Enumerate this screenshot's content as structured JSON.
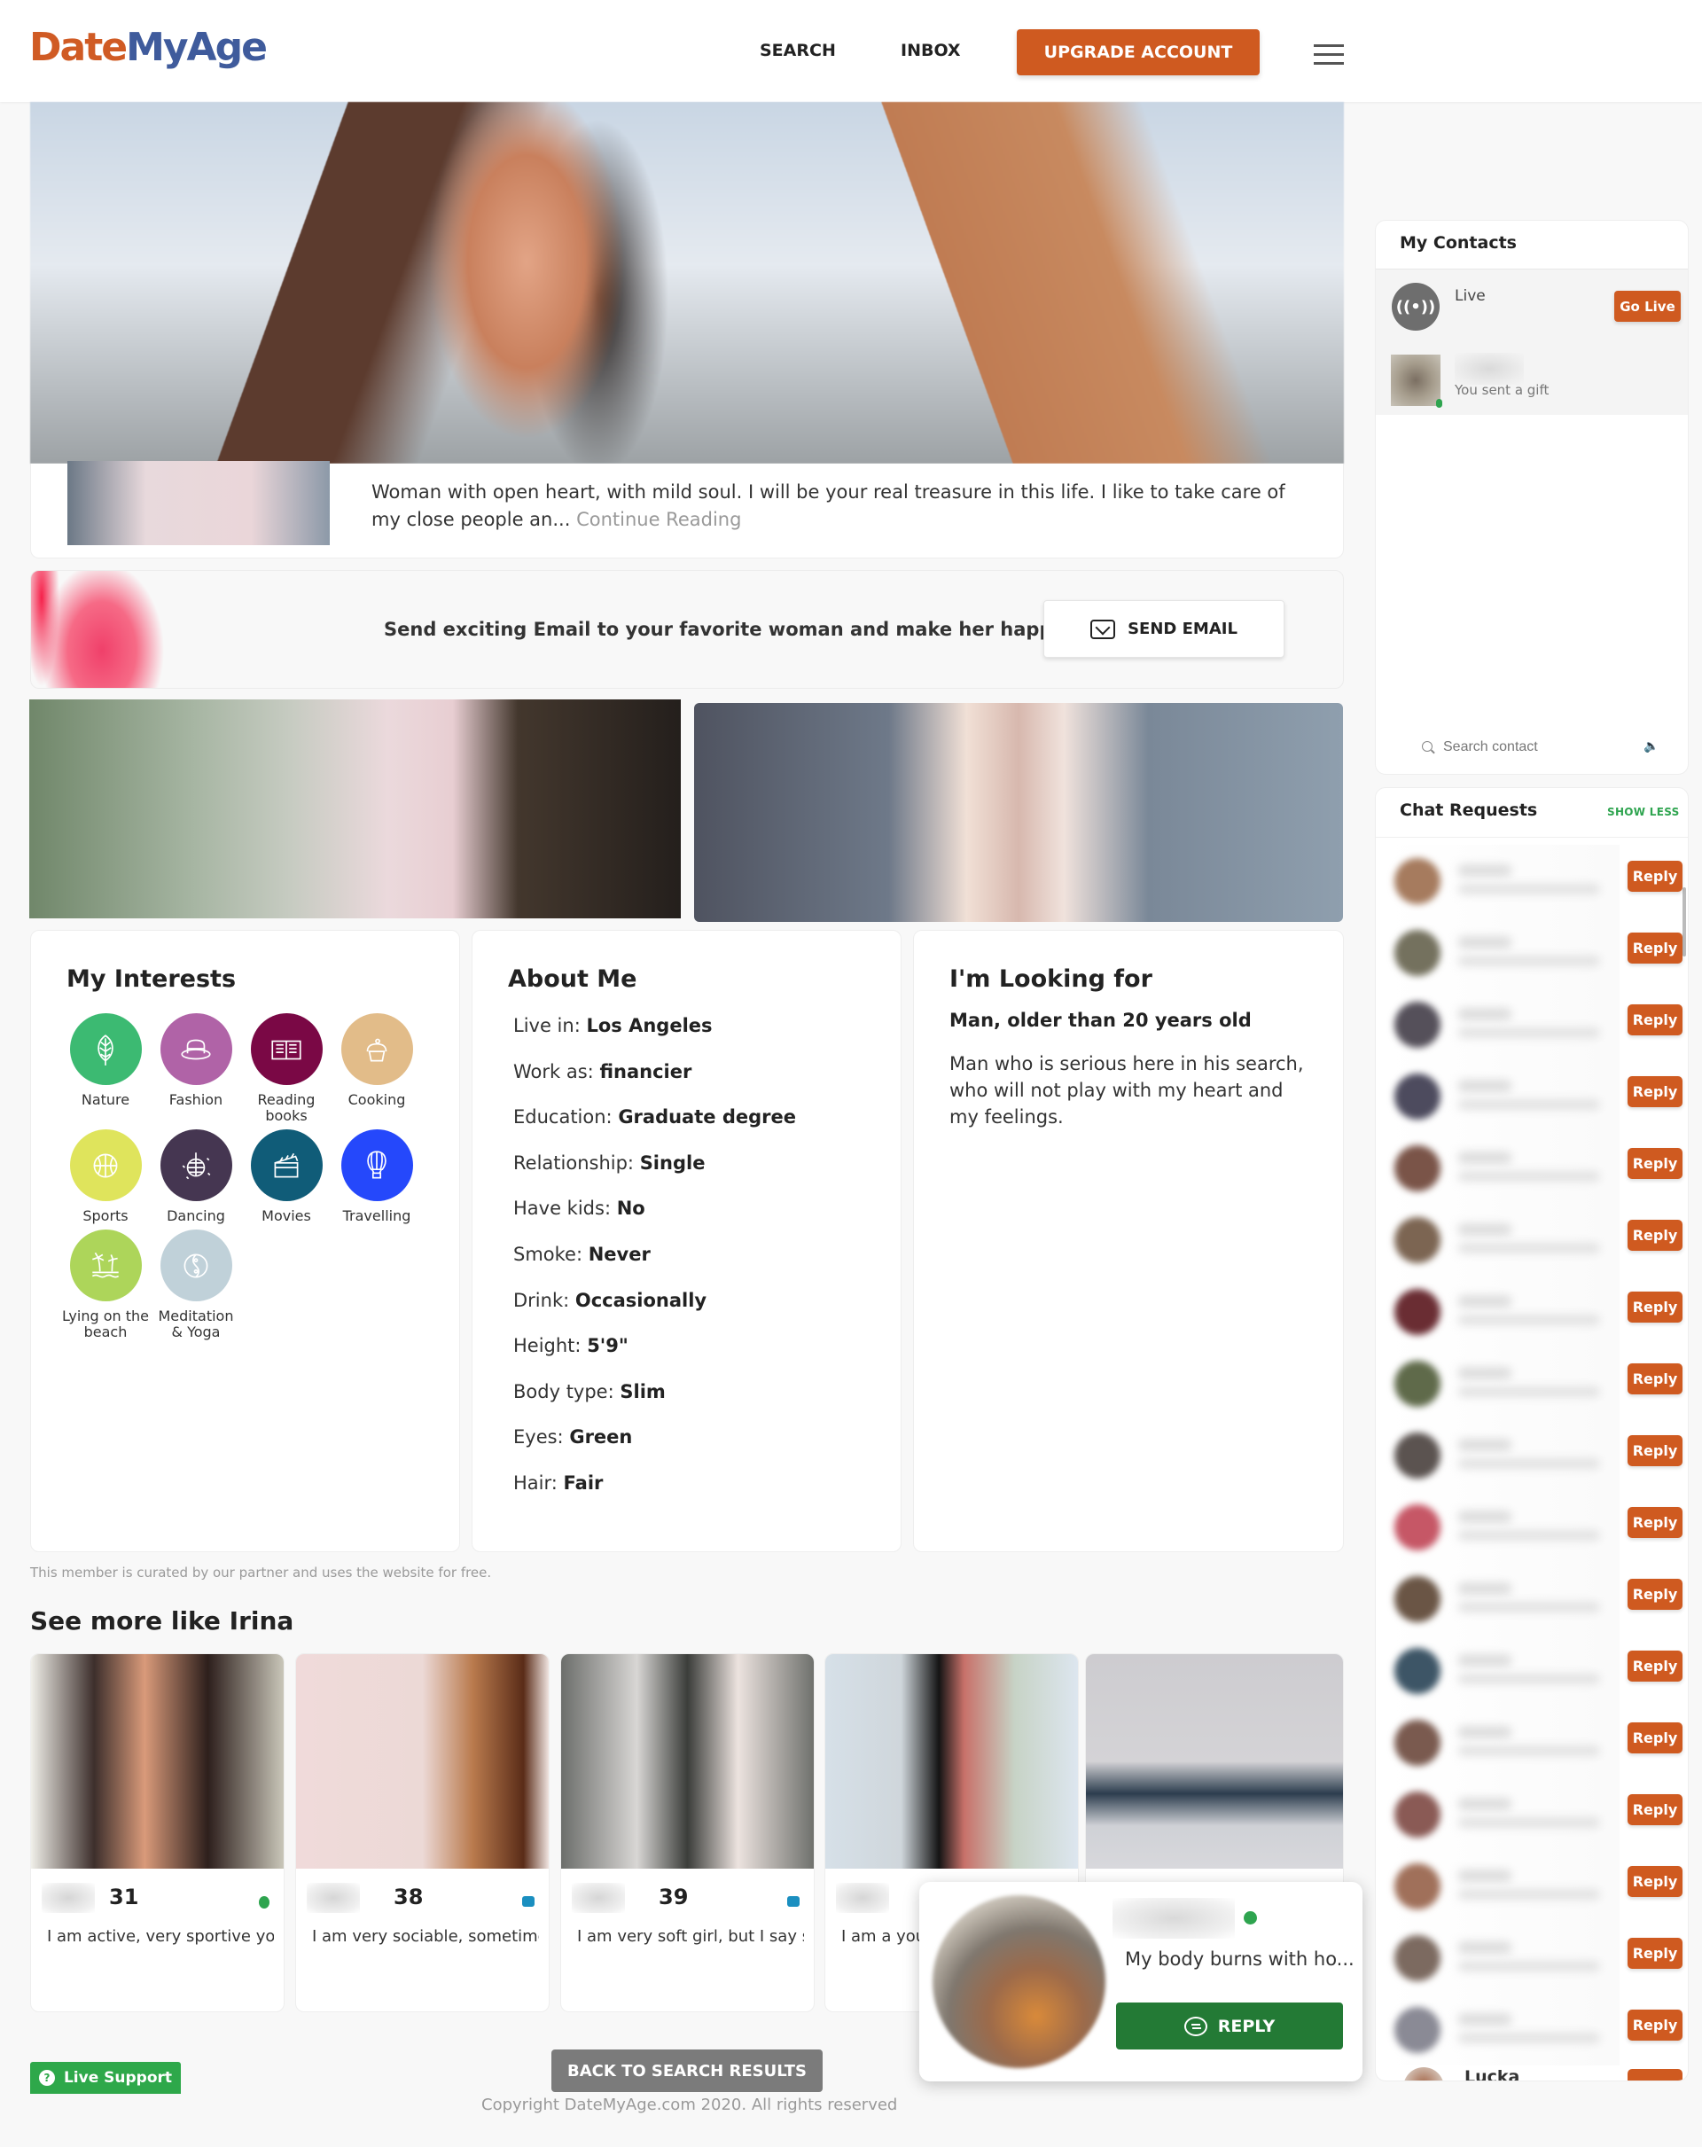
{
  "header": {
    "logo_part1": "Date",
    "logo_part2": "MyAge",
    "nav_search": "SEARCH",
    "nav_inbox": "INBOX",
    "upgrade_label": "UPGRADE ACCOUNT",
    "menu_icon": "hamburger-icon",
    "brand_color": "#cf5a20",
    "logo_blue": "#3f5b9c"
  },
  "profile": {
    "bio": "Woman with open heart, with mild soul. I will be your real treasure in this life. I like to take care of my close people an...",
    "continue_label": "Continue Reading",
    "email_banner_text": "Send exciting Email to your favorite woman and make her happy!",
    "send_email_label": "SEND EMAIL"
  },
  "interests": {
    "title": "My Interests",
    "items": [
      {
        "label": "Nature",
        "icon": "leaf-icon",
        "color": "#3cba72"
      },
      {
        "label": "Fashion",
        "icon": "hat-icon",
        "color": "#b063a7"
      },
      {
        "label": "Reading books",
        "icon": "book-icon",
        "color": "#7a0845"
      },
      {
        "label": "Cooking",
        "icon": "cupcake-icon",
        "color": "#e2bc89"
      },
      {
        "label": "Sports",
        "icon": "basketball-icon",
        "color": "#dfe45c"
      },
      {
        "label": "Dancing",
        "icon": "disco-ball-icon",
        "color": "#453651"
      },
      {
        "label": "Movies",
        "icon": "clapperboard-icon",
        "color": "#105c78"
      },
      {
        "label": "Travelling",
        "icon": "hot-air-balloon-icon",
        "color": "#2548fb"
      },
      {
        "label": "Lying on the beach",
        "icon": "palm-island-icon",
        "color": "#add55a"
      },
      {
        "label": "Meditation & Yoga",
        "icon": "yin-yang-icon",
        "color": "#c0d1d9"
      }
    ]
  },
  "about": {
    "title": "About Me",
    "rows": [
      {
        "label": "Live in:",
        "value": "Los Angeles"
      },
      {
        "label": "Work as:",
        "value": "financier"
      },
      {
        "label": "Education:",
        "value": "Graduate degree"
      },
      {
        "label": "Relationship:",
        "value": "Single"
      },
      {
        "label": "Have kids:",
        "value": "No"
      },
      {
        "label": "Smoke:",
        "value": "Never"
      },
      {
        "label": "Drink:",
        "value": "Occasionally"
      },
      {
        "label": "Height:",
        "value": "5'9\""
      },
      {
        "label": "Body type:",
        "value": "Slim"
      },
      {
        "label": "Eyes:",
        "value": "Green"
      },
      {
        "label": "Hair:",
        "value": "Fair"
      }
    ]
  },
  "looking": {
    "title": "I'm Looking for",
    "subtitle": "Man, older than 20 years old",
    "text": "Man who is serious here in his search, who will not play with my heart and my feelings."
  },
  "curated_note": "This member is curated by our partner and uses the website for free.",
  "similar": {
    "title": "See more like Irina",
    "cards": [
      {
        "age": "31",
        "status": "online",
        "desc": "I am active, very sportive you"
      },
      {
        "age": "38",
        "status": "video",
        "desc": "I am very sociable, sometimes"
      },
      {
        "age": "39",
        "status": "video",
        "desc": "I am very soft girl, but I say s"
      },
      {
        "age": "",
        "status": "",
        "desc": "I am a you"
      },
      {
        "age": "",
        "status": "",
        "desc": ""
      }
    ]
  },
  "popup": {
    "message": "My body burns with ho...",
    "reply_label": "REPLY"
  },
  "footer": {
    "live_support": "Live Support",
    "back_label": "BACK TO SEARCH RESULTS",
    "copyright": "Copyright DateMyAge.com 2020. All rights reserved"
  },
  "contacts": {
    "title": "My Contacts",
    "live_label": "Live",
    "live_icon_glyph": "((•))",
    "go_live_label": "Go Live",
    "contact_status": "You sent a gift",
    "search_placeholder": "Search contact",
    "sound_glyph": "🔈"
  },
  "chat_requests": {
    "title": "Chat Requests",
    "show_less": "SHOW LESS",
    "reply_label": "Reply",
    "rows": [
      {
        "avatar_color": "#a67b5e"
      },
      {
        "avatar_color": "#74715e"
      },
      {
        "avatar_color": "#55505a"
      },
      {
        "avatar_color": "#4d4b5e"
      },
      {
        "avatar_color": "#7a5448"
      },
      {
        "avatar_color": "#7c6552"
      },
      {
        "avatar_color": "#6a2d33"
      },
      {
        "avatar_color": "#5f6a4a"
      },
      {
        "avatar_color": "#5b5350"
      },
      {
        "avatar_color": "#c65766"
      },
      {
        "avatar_color": "#6a5545"
      },
      {
        "avatar_color": "#3d5566"
      },
      {
        "avatar_color": "#7a5a4f"
      },
      {
        "avatar_color": "#8a5a55"
      },
      {
        "avatar_color": "#a0705a"
      },
      {
        "avatar_color": "#7c6a60"
      },
      {
        "avatar_color": "#8a8a95"
      }
    ],
    "last_name": "Lucka"
  }
}
